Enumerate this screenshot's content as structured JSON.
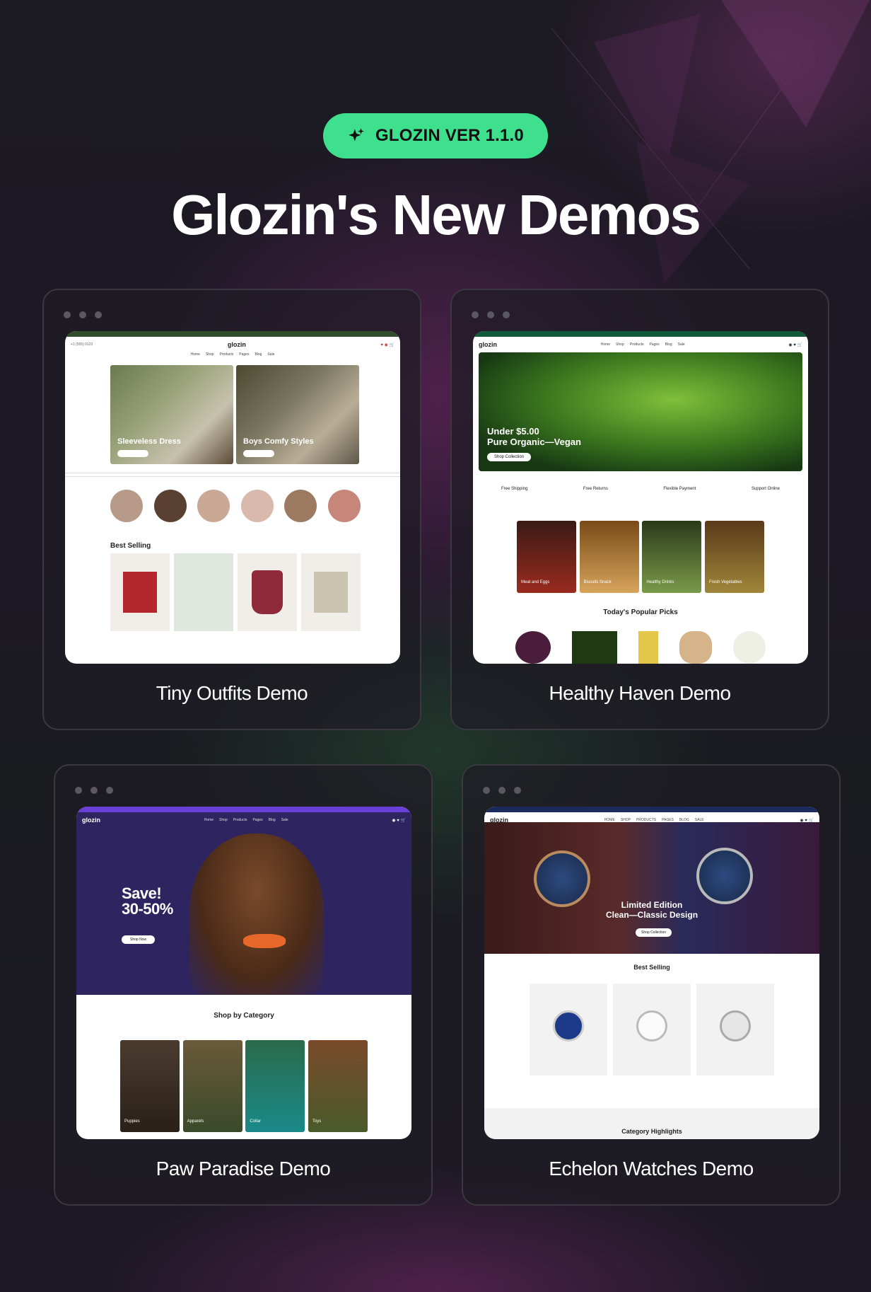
{
  "badge": {
    "label": "GLOZIN VER 1.1.0",
    "icon": "sparkle-icon"
  },
  "title": "Glozin's New Demos",
  "demos": [
    {
      "label": "Tiny Outfits Demo",
      "hero": [
        "Sleeveless Dress",
        "Boys Comfy Styles"
      ],
      "section": "Best Selling",
      "accent": "#2f4d2a"
    },
    {
      "label": "Healthy Haven Demo",
      "hero": "Under $5.00\nPure Organic—Vegan",
      "hero_button": "Shop Collection",
      "features": [
        "Free Shipping",
        "Free Returns",
        "Flexible Payment",
        "Support Online"
      ],
      "categories": [
        "Meat and Eggs",
        "Biscuits Snack",
        "Healthy Drinks",
        "Fresh Vegetables"
      ],
      "section": "Today's Popular Picks",
      "accent": "#0e5a3a"
    },
    {
      "label": "Paw Paradise Demo",
      "hero": "Save!\n30-50%",
      "hero_button": "Shop Now",
      "section": "Shop by Category",
      "categories": [
        "Puppies",
        "Apparels",
        "Collar",
        "Toys"
      ],
      "accent": "#2e2560"
    },
    {
      "label": "Echelon Watches Demo",
      "hero": "Limited Edition\nClean—Classic Design",
      "hero_button": "Shop Collection",
      "section": "Best Selling",
      "section2": "Category Highlights",
      "accent": "#1b2a5c"
    }
  ],
  "logo": "glozin",
  "colors": {
    "badge": "#3ee08e",
    "background": "#1a1720"
  }
}
